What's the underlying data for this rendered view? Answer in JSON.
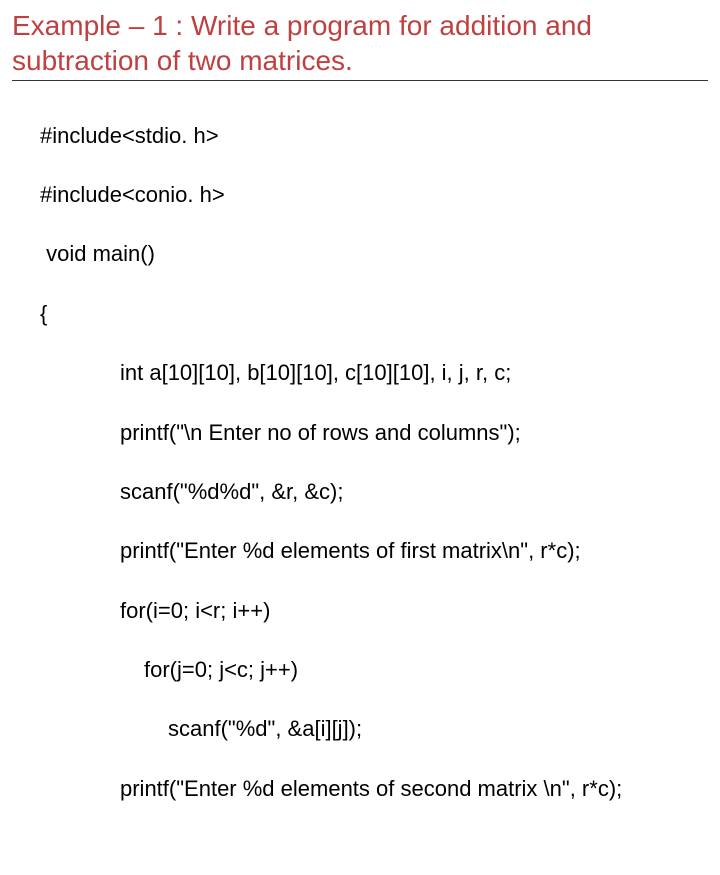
{
  "heading": "Example – 1 : Write a program for addition and subtraction of two matrices.",
  "code": {
    "l1": "#include<stdio. h>",
    "l2": "#include<conio. h>",
    "l3": " void main()",
    "l4": "{",
    "l5": "int a[10][10], b[10][10], c[10][10], i, j, r, c;",
    "l6": "printf(\"\\n Enter no of rows and columns\");",
    "l7": "scanf(\"%d%d\", &r, &c);",
    "l8": "printf(\"Enter %d elements of first matrix\\n\", r*c);",
    "l9": "for(i=0; i<r; i++)",
    "l10": "for(j=0; j<c; j++)",
    "l11": "scanf(\"%d\", &a[i][j]);",
    "l12": "printf(\"Enter %d elements of second matrix \\n\", r*c);"
  }
}
